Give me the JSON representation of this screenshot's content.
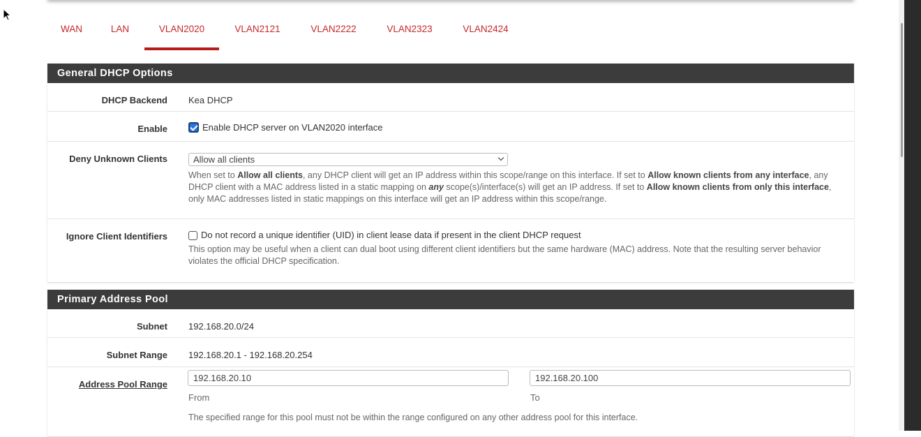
{
  "tabs": [
    {
      "label": "WAN",
      "active": false
    },
    {
      "label": "LAN",
      "active": false
    },
    {
      "label": "VLAN2020",
      "active": true
    },
    {
      "label": "VLAN2121",
      "active": false
    },
    {
      "label": "VLAN2222",
      "active": false
    },
    {
      "label": "VLAN2323",
      "active": false
    },
    {
      "label": "VLAN2424",
      "active": false
    }
  ],
  "general": {
    "heading": "General DHCP Options",
    "backend": {
      "label": "DHCP Backend",
      "value": "Kea DHCP"
    },
    "enable": {
      "label": "Enable",
      "checkbox_label": "Enable DHCP server on VLAN2020 interface",
      "checked": true
    },
    "deny_unknown": {
      "label": "Deny Unknown Clients",
      "selected": "Allow all clients",
      "help": {
        "p1": "When set to ",
        "b1": "Allow all clients",
        "p2": ", any DHCP client will get an IP address within this scope/range on this interface. If set to ",
        "b2": "Allow known clients from any interface",
        "p3": ", any DHCP client with a MAC address listed in a static mapping on ",
        "b3": "any",
        "p4": " scope(s)/interface(s) will get an IP address. If set to ",
        "b4": "Allow known clients from only this interface",
        "p5": ", only MAC addresses listed in static mappings on this interface will get an IP address within this scope/range."
      }
    },
    "ignore_client_ids": {
      "label": "Ignore Client Identifiers",
      "checkbox_label": "Do not record a unique identifier (UID) in client lease data if present in the client DHCP request",
      "checked": false,
      "help": "This option may be useful when a client can dual boot using different client identifiers but the same hardware (MAC) address. Note that the resulting server behavior violates the official DHCP specification."
    }
  },
  "pool": {
    "heading": "Primary Address Pool",
    "subnet": {
      "label": "Subnet",
      "value": "192.168.20.0/24"
    },
    "subnet_range": {
      "label": "Subnet Range",
      "value": "192.168.20.1 - 192.168.20.254"
    },
    "range": {
      "label": "Address Pool Range",
      "from_value": "192.168.20.10",
      "from_label": "From",
      "to_value": "192.168.20.100",
      "to_label": "To",
      "help": "The specified range for this pool must not be within the range configured on any other address pool for this interface."
    }
  },
  "colors": {
    "accent": "#c62828",
    "heading_bg": "#3c3c3c",
    "checkbox": "#2a75d8"
  }
}
